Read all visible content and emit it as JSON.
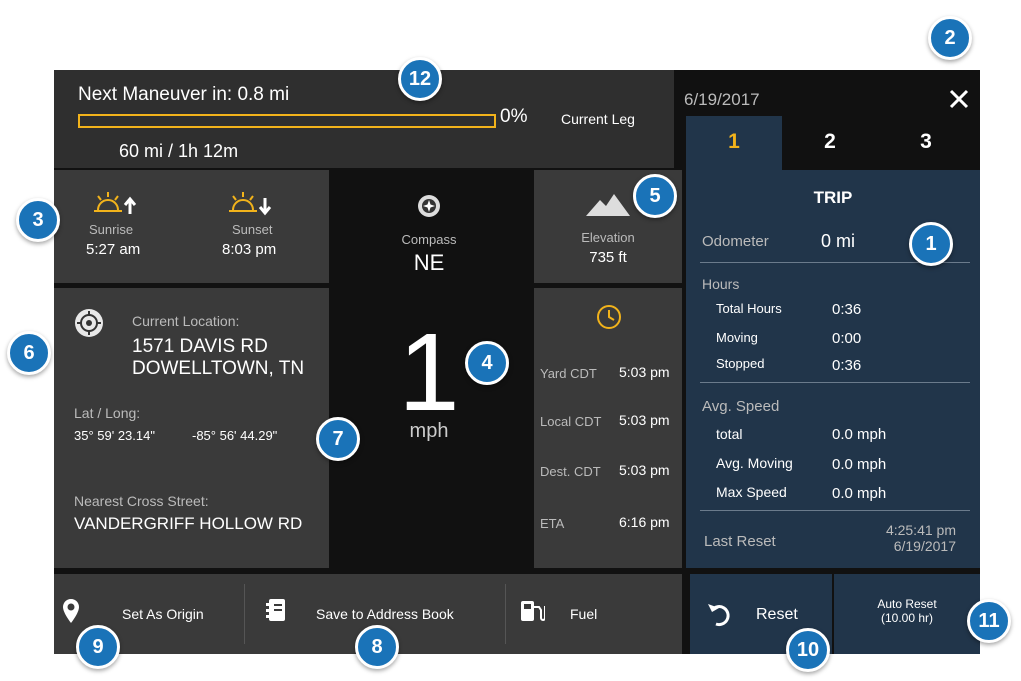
{
  "header": {
    "next_maneuver": "Next Maneuver in: 0.8 mi",
    "progress_percent_label": "0%",
    "progress_fraction": 0,
    "current_leg": "Current Leg",
    "distance_time": "60 mi / 1h 12m"
  },
  "sun": {
    "sunrise_label": "Sunrise",
    "sunrise_time": "5:27 am",
    "sunset_label": "Sunset",
    "sunset_time": "8:03 pm"
  },
  "compass": {
    "label": "Compass",
    "value": "NE"
  },
  "elevation": {
    "label": "Elevation",
    "value": "735 ft"
  },
  "location": {
    "label": "Current Location:",
    "line1": "1571 DAVIS RD",
    "line2": "DOWELLTOWN, TN",
    "latlong_label": "Lat / Long:",
    "lat": "35° 59' 23.14\"",
    "long": "-85° 56' 44.29\"",
    "cross_label": "Nearest Cross Street:",
    "cross_value": "VANDERGRIFF HOLLOW RD"
  },
  "speed": {
    "value": "1",
    "unit": "mph"
  },
  "clocks": [
    {
      "label": "Yard CDT",
      "time": "5:03 pm"
    },
    {
      "label": "Local CDT",
      "time": "5:03 pm"
    },
    {
      "label": "Dest. CDT",
      "time": "5:03 pm"
    },
    {
      "label": "ETA",
      "time": "6:16 pm"
    }
  ],
  "trip": {
    "date": "6/19/2017",
    "tabs": [
      "1",
      "2",
      "3"
    ],
    "title": "TRIP",
    "odometer_label": "Odometer",
    "odometer_value": "0 mi",
    "hours_label": "Hours",
    "hours": [
      {
        "label": "Total Hours",
        "value": "0:36"
      },
      {
        "label": "Moving",
        "value": "0:00"
      },
      {
        "label": "Stopped",
        "value": "0:36"
      }
    ],
    "avg_label": "Avg. Speed",
    "speeds": [
      {
        "label": "total",
        "value": "0.0 mph"
      },
      {
        "label": "Avg. Moving",
        "value": "0.0 mph"
      },
      {
        "label": "Max Speed",
        "value": "0.0 mph"
      }
    ],
    "last_reset_label": "Last Reset",
    "last_reset_time": "4:25:41 pm",
    "last_reset_date": "6/19/2017"
  },
  "toolbar": {
    "origin": "Set As Origin",
    "address_book": "Save to Address Book",
    "fuel": "Fuel",
    "reset": "Reset",
    "auto_reset_1": "Auto Reset",
    "auto_reset_2": "(10.00 hr)"
  },
  "callouts": [
    "1",
    "2",
    "3",
    "4",
    "5",
    "6",
    "7",
    "8",
    "9",
    "10",
    "11",
    "12"
  ],
  "colors": {
    "accent": "#f2b31b",
    "badge": "#1a73b8",
    "panel": "#21354a"
  }
}
